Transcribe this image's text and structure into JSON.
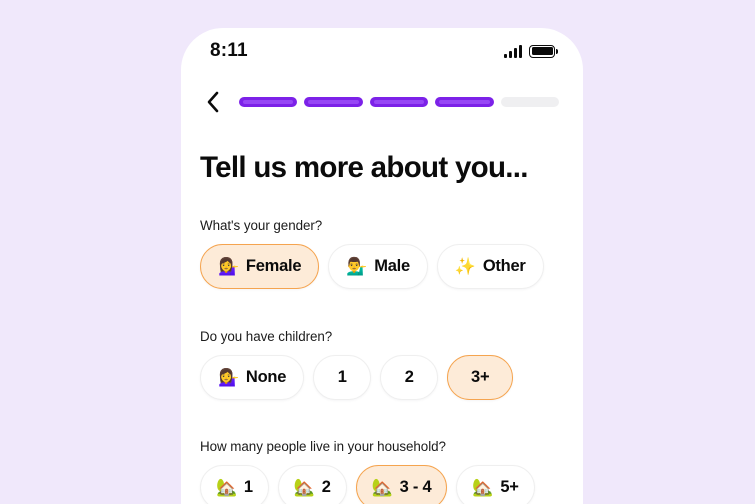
{
  "background_color": "#F0E8FB",
  "accent_color": "#7C22E8",
  "selected_border_color": "#F5A44F",
  "selected_fill_color": "#FDEBD8",
  "status_bar": {
    "time": "8:11",
    "signal_icon": "cellular-signal-icon",
    "battery_icon": "battery-full-icon"
  },
  "nav": {
    "back_icon": "chevron-left-icon",
    "progress": {
      "total_steps": 5,
      "completed_steps": 4,
      "segments": [
        true,
        true,
        true,
        true,
        false
      ]
    }
  },
  "header": {
    "title": "Tell us more about you..."
  },
  "questions": [
    {
      "id": "gender",
      "label": "What's your gender?",
      "options": [
        {
          "emoji": "💁‍♀️",
          "icon_name": "woman-tipping-hand-emoji",
          "label": "Female",
          "selected": true
        },
        {
          "emoji": "💁‍♂️",
          "icon_name": "man-tipping-hand-emoji",
          "label": "Male",
          "selected": false
        },
        {
          "emoji": "✨",
          "icon_name": "sparkles-emoji",
          "label": "Other",
          "selected": false
        }
      ]
    },
    {
      "id": "children",
      "label": "Do you have children?",
      "options": [
        {
          "emoji": "💁‍♀️",
          "icon_name": "woman-tipping-hand-emoji",
          "label": "None",
          "selected": false
        },
        {
          "emoji": "",
          "icon_name": "",
          "label": "1",
          "selected": false
        },
        {
          "emoji": "",
          "icon_name": "",
          "label": "2",
          "selected": false
        },
        {
          "emoji": "",
          "icon_name": "",
          "label": "3+",
          "selected": true
        }
      ]
    },
    {
      "id": "household",
      "label": "How many people live in your household?",
      "options": [
        {
          "emoji": "🏡",
          "icon_name": "house-with-garden-emoji",
          "label": "1",
          "selected": false
        },
        {
          "emoji": "🏡",
          "icon_name": "house-with-garden-emoji",
          "label": "2",
          "selected": false
        },
        {
          "emoji": "🏡",
          "icon_name": "house-with-garden-emoji",
          "label": "3 - 4",
          "selected": true
        },
        {
          "emoji": "🏡",
          "icon_name": "house-with-garden-emoji",
          "label": "5+",
          "selected": false
        }
      ]
    }
  ]
}
